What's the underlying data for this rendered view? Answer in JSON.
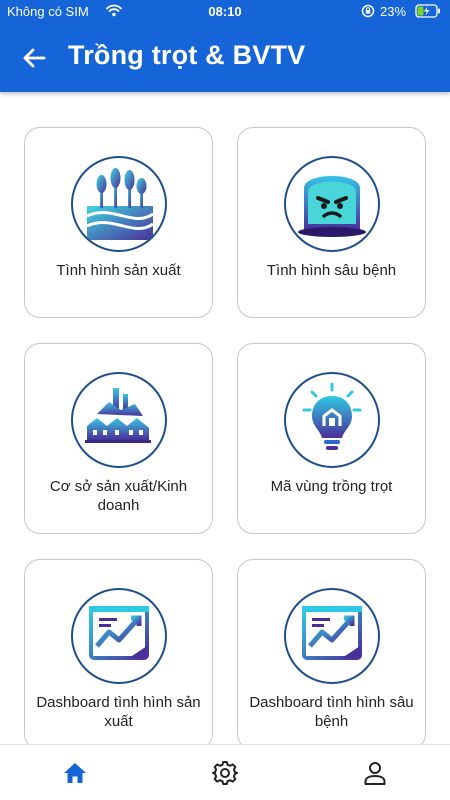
{
  "status_bar": {
    "carrier": "Không có SIM",
    "time": "08:10",
    "battery_percent": "23%"
  },
  "header": {
    "title": "Trồng trọt & BVTV",
    "back_icon": "arrow-left-icon"
  },
  "cards": [
    {
      "label": "Tình hình sản xuất",
      "icon": "crop-field-icon"
    },
    {
      "label": "Tình hình sâu bệnh",
      "icon": "pest-monster-icon"
    },
    {
      "label": "Cơ sở sản xuất/Kinh doanh",
      "icon": "factory-town-icon"
    },
    {
      "label": "Mã vùng trồng trọt",
      "icon": "lightbulb-building-icon"
    },
    {
      "label": "Dashboard tình hình sản xuất",
      "icon": "dashboard-chart-icon"
    },
    {
      "label": "Dashboard tình hình sâu bệnh",
      "icon": "dashboard-chart-icon"
    }
  ],
  "bottom_nav": {
    "items": [
      {
        "icon": "home-icon",
        "active": true
      },
      {
        "icon": "gear-icon",
        "active": false
      },
      {
        "icon": "user-icon",
        "active": false
      }
    ]
  },
  "colors": {
    "primary": "#1565d8",
    "nav_active": "#1565d8",
    "nav_inactive": "#222222",
    "card_border": "#c8c8c8"
  }
}
